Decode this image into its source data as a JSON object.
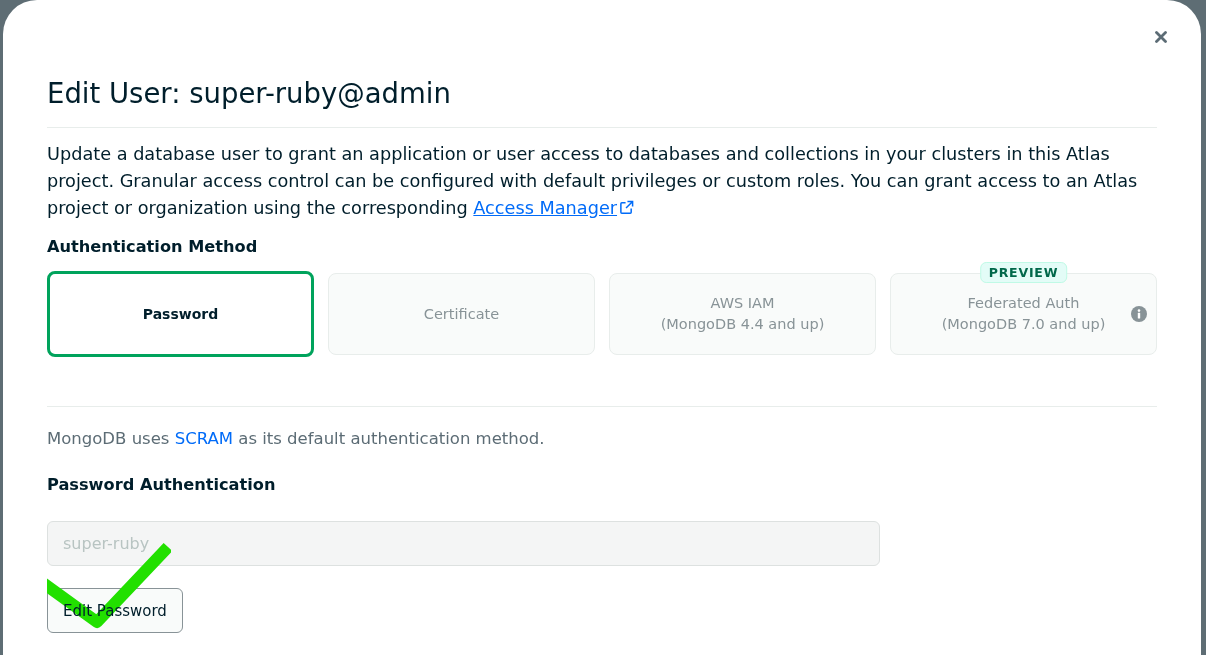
{
  "dialog": {
    "title": "Edit User: super-ruby@admin"
  },
  "description": {
    "text": "Update a database user to grant an application or user access to databases and collections in your clusters in this Atlas project. Granular access control can be configured with default privileges or custom roles. You can grant access to an Atlas project or organization using the corresponding",
    "link": "Access Manager"
  },
  "authentication_method": {
    "heading": "Authentication Method",
    "options": [
      {
        "label": "Password",
        "selected": true,
        "disabled": false,
        "info": false
      },
      {
        "label": "Certificate",
        "selected": false,
        "disabled": true,
        "info": false
      },
      {
        "label": "AWS IAM",
        "note": "(MongoDB 4.4 and up)",
        "selected": false,
        "disabled": true,
        "info": false
      },
      {
        "label": "Federated Auth",
        "note": "(MongoDB 7.0 and up)",
        "badge": "PREVIEW",
        "selected": false,
        "disabled": true,
        "info": true
      }
    ]
  },
  "scram_note": {
    "before": "MongoDB uses",
    "link": "SCRAM",
    "after": "as its default authentication method."
  },
  "password_authentication": {
    "heading": "Password Authentication",
    "username": {
      "value": "super-ruby",
      "disabled": true
    },
    "button": "Edit Password"
  }
}
